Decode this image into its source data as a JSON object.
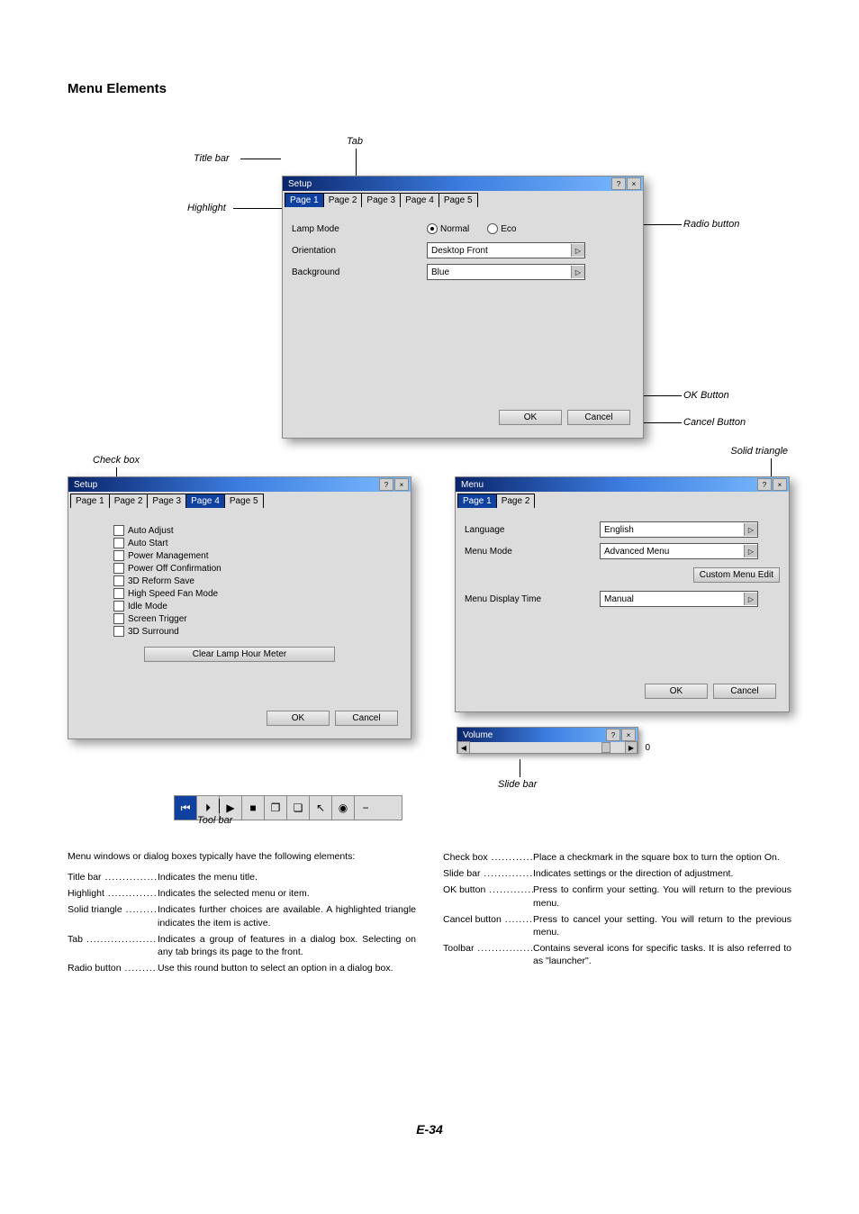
{
  "section_title": "Menu Elements",
  "labels": {
    "title_bar": "Title bar",
    "tab": "Tab",
    "highlight": "Highlight",
    "radio_button": "Radio button",
    "ok_button": "OK Button",
    "cancel_button": "Cancel Button",
    "check_box": "Check box",
    "solid_triangle": "Solid triangle",
    "tool_bar": "Tool bar",
    "slide_bar": "Slide bar"
  },
  "dialog1": {
    "title": "Setup",
    "tabs": [
      "Page 1",
      "Page 2",
      "Page 3",
      "Page 4",
      "Page 5"
    ],
    "active_tab": 0,
    "lamp_mode_label": "Lamp Mode",
    "lamp_normal": "Normal",
    "lamp_eco": "Eco",
    "orientation_label": "Orientation",
    "orientation_value": "Desktop Front",
    "background_label": "Background",
    "background_value": "Blue",
    "ok": "OK",
    "cancel": "Cancel"
  },
  "dialog2": {
    "title": "Setup",
    "tabs": [
      "Page 1",
      "Page 2",
      "Page 3",
      "Page 4",
      "Page 5"
    ],
    "active_tab": 3,
    "items": [
      "Auto Adjust",
      "Auto Start",
      "Power Management",
      "Power Off Confirmation",
      "3D Reform Save",
      "High Speed Fan Mode",
      "Idle Mode",
      "Screen Trigger",
      "3D Surround"
    ],
    "clear_btn": "Clear Lamp Hour Meter",
    "ok": "OK",
    "cancel": "Cancel"
  },
  "dialog3": {
    "title": "Menu",
    "tabs": [
      "Page 1",
      "Page 2"
    ],
    "active_tab": 0,
    "language_label": "Language",
    "language_value": "English",
    "menu_mode_label": "Menu Mode",
    "menu_mode_value": "Advanced Menu",
    "custom_edit": "Custom Menu Edit",
    "display_time_label": "Menu Display Time",
    "display_time_value": "Manual",
    "ok": "OK",
    "cancel": "Cancel"
  },
  "volume": {
    "title": "Volume",
    "value": "0"
  },
  "lead_in": "Menu windows or dialog boxes typically have the following elements:",
  "defs_left": [
    {
      "term": "Title bar",
      "val": "Indicates the menu title."
    },
    {
      "term": "Highlight",
      "val": "Indicates the selected menu or item."
    },
    {
      "term": "Solid triangle",
      "val": "Indicates further choices are available. A highlighted triangle indicates the item is active."
    },
    {
      "term": "Tab",
      "val": "Indicates a group of features in a dialog box. Selecting on any tab brings its page to the front."
    },
    {
      "term": "Radio button",
      "val": "Use this round button to select an option in a dialog box."
    }
  ],
  "defs_right": [
    {
      "term": "Check box",
      "val": "Place a checkmark in the square box to turn the option On."
    },
    {
      "term": "Slide bar",
      "val": "Indicates settings or the direction of adjustment."
    },
    {
      "term": "OK button",
      "val": "Press to confirm your setting. You will return to the previous menu."
    },
    {
      "term": "Cancel button",
      "val": "Press to cancel your setting. You will return to the previous menu."
    },
    {
      "term": "Toolbar",
      "val": "Contains several icons for specific tasks. It is also referred to as \"launcher\"."
    }
  ],
  "page_num": "E-34"
}
